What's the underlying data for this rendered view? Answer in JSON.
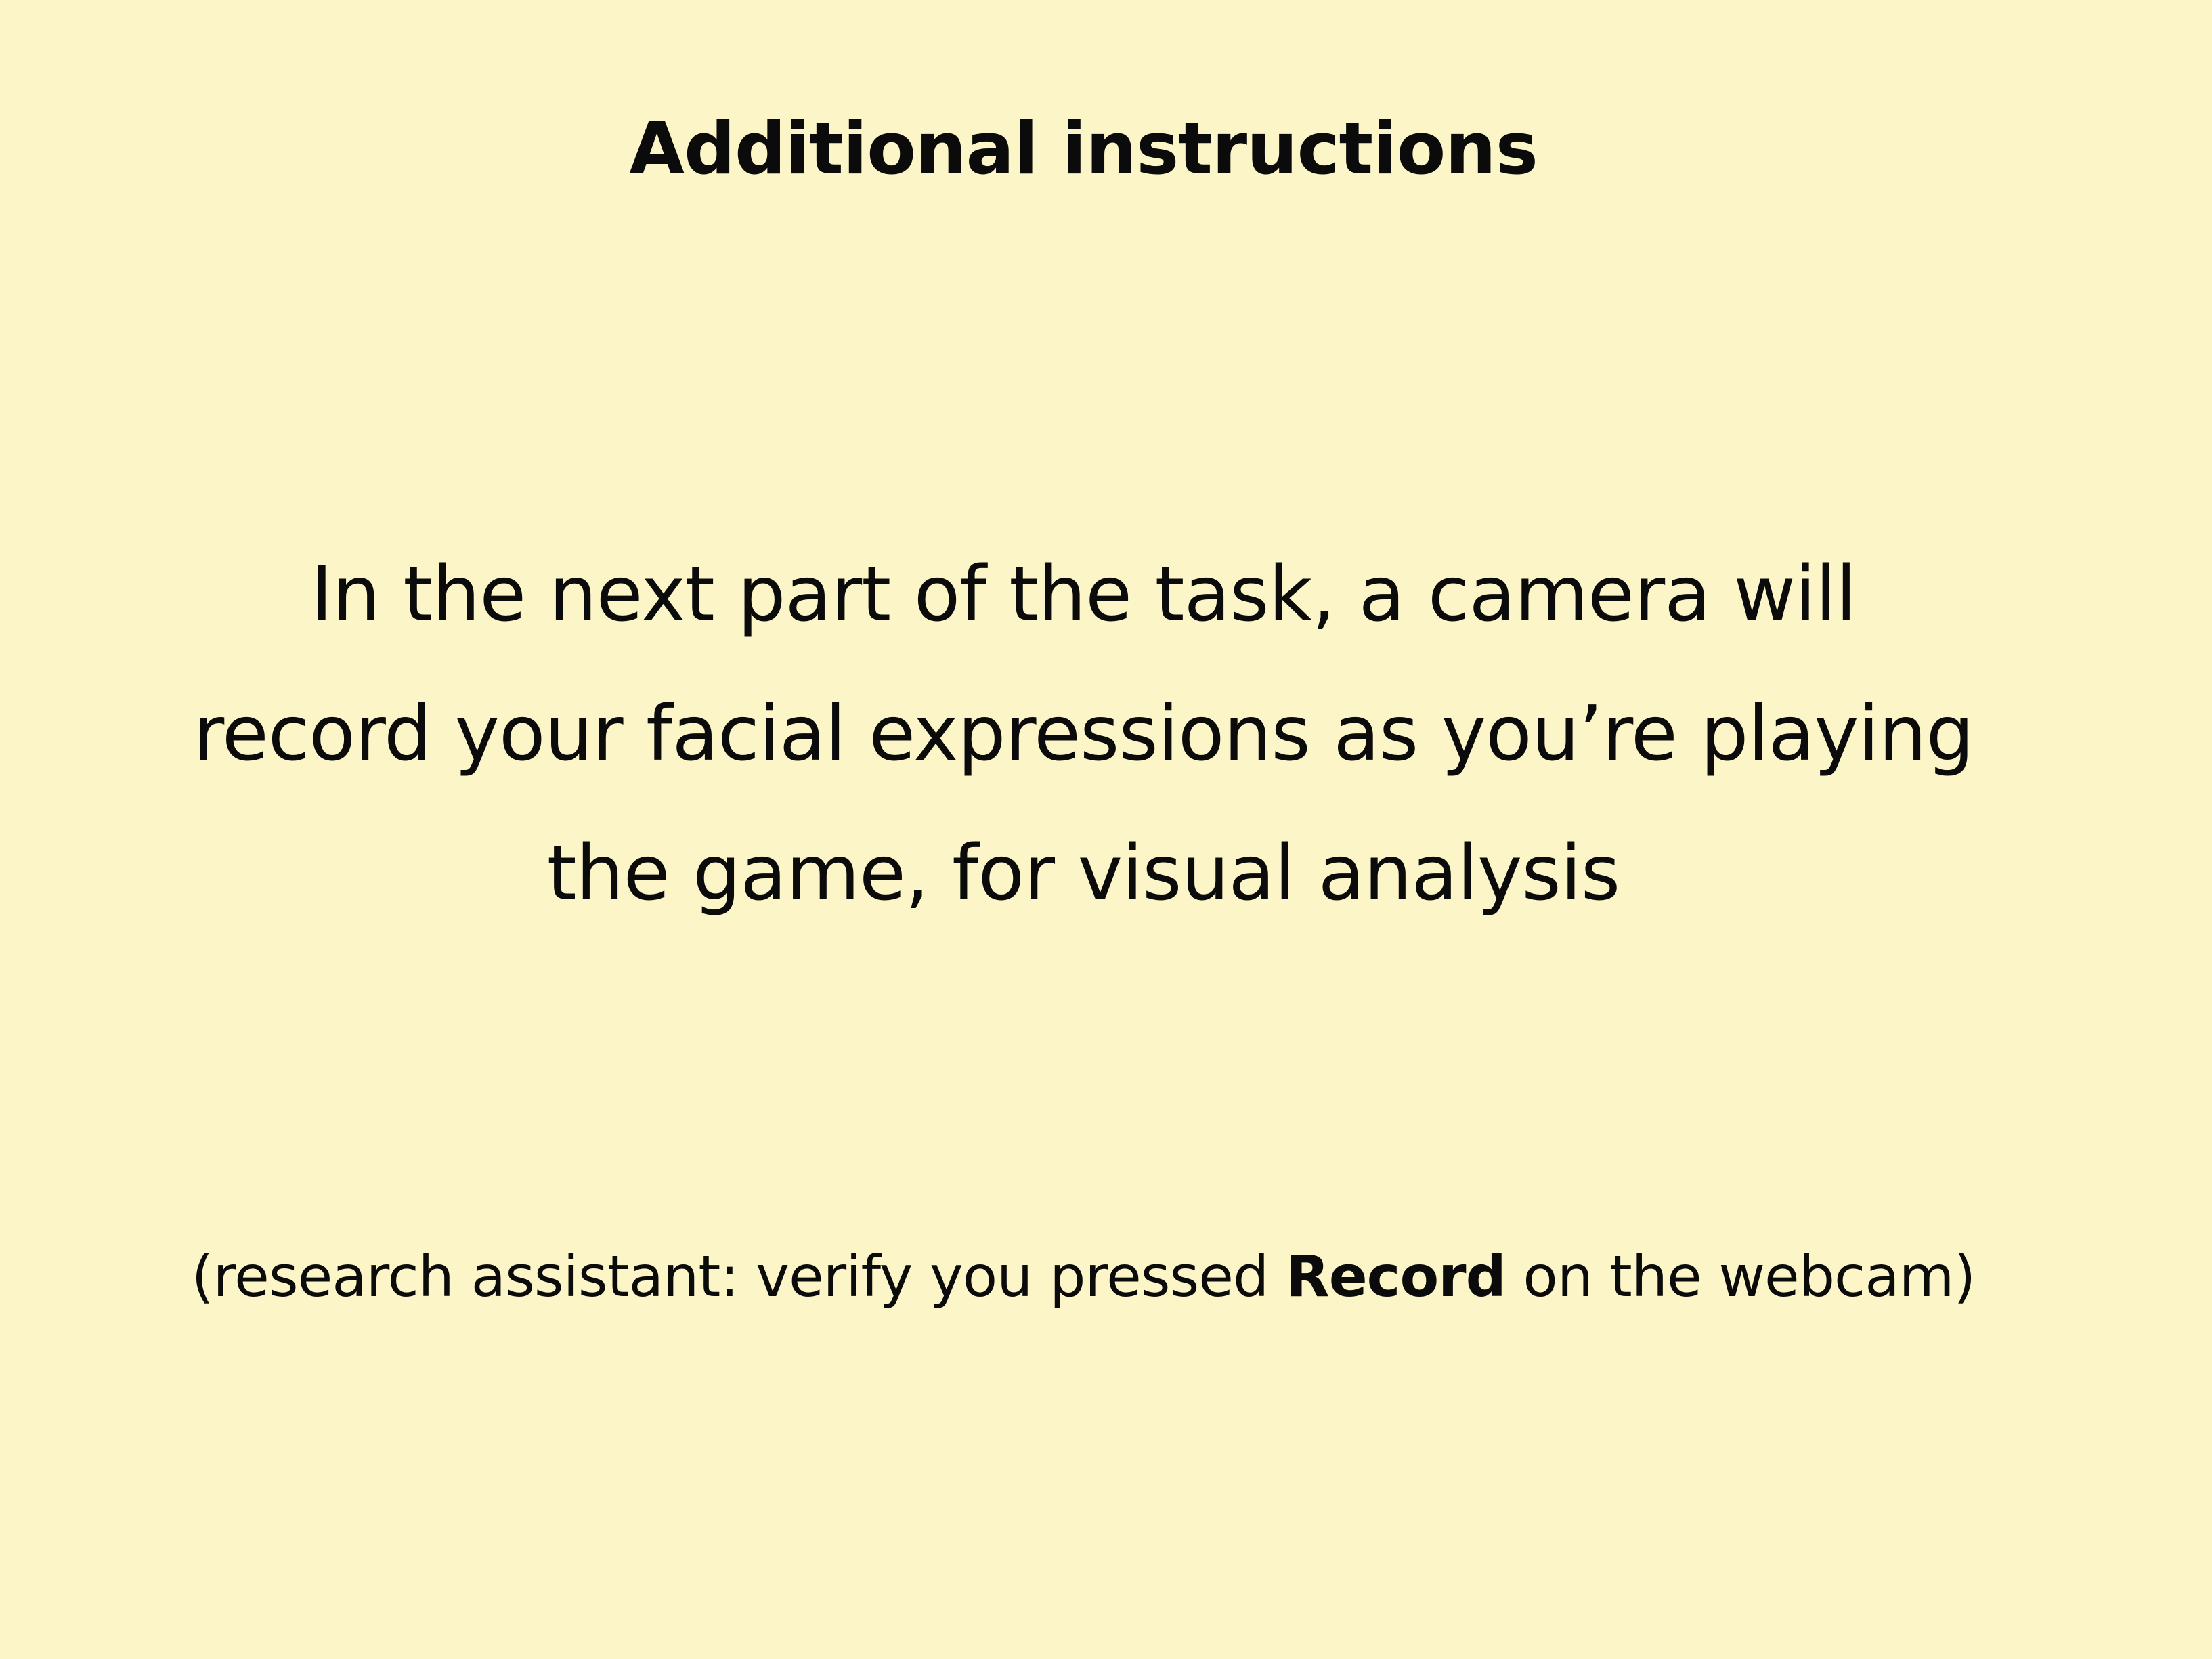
{
  "slide": {
    "background_color": "#fcf5c7",
    "text_color": "#0b0b0b",
    "title": "Additional instructions",
    "body_lines": [
      "In the next part of the task, a camera will",
      "record your facial expressions as you’re playing",
      "the game, for visual analysis"
    ],
    "note": {
      "before": "(research assistant: verify you pressed ",
      "emphasis": "Record",
      "after": " on the webcam)"
    }
  }
}
